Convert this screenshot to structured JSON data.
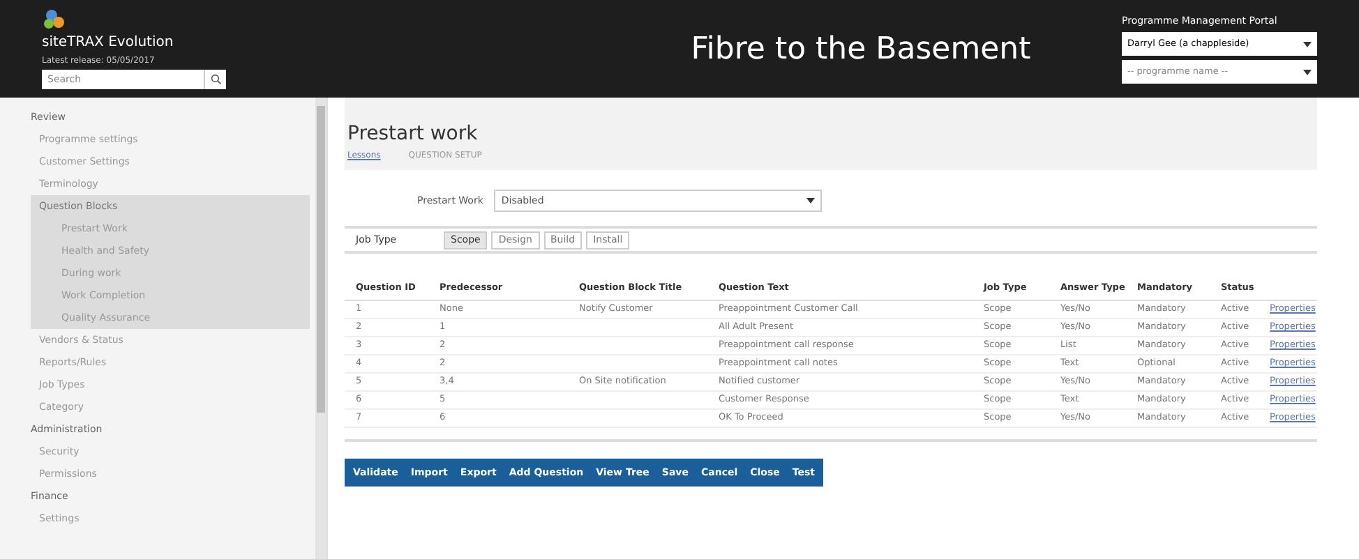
{
  "header": {
    "app_name": "siteTRAX Evolution",
    "release": "Latest release: 05/05/2017",
    "search": {
      "placeholder": "Search"
    },
    "page_title": "Fibre to the Basement",
    "portal_title": "Programme Management Portal",
    "user_select": "Darryl Gee (a chappleside)",
    "programme_select": "-- programme name --"
  },
  "sidebar": {
    "sections": [
      {
        "title": "Review",
        "items": [
          {
            "label": "Programme settings",
            "selected": false
          },
          {
            "label": "Customer Settings",
            "selected": false
          },
          {
            "label": "Terminology",
            "selected": false
          },
          {
            "label": "Question Blocks",
            "selected": true,
            "children": [
              {
                "label": "Prestart Work",
                "selected": false
              },
              {
                "label": "Health and Safety",
                "selected": false
              },
              {
                "label": "During work",
                "selected": false
              },
              {
                "label": "Work Completion",
                "selected": false
              },
              {
                "label": "Quality Assurance",
                "selected": false
              }
            ]
          },
          {
            "label": "Vendors & Status",
            "selected": false
          },
          {
            "label": "Reports/Rules",
            "selected": false
          },
          {
            "label": "Job Types",
            "selected": false
          },
          {
            "label": "Category",
            "selected": false
          }
        ]
      },
      {
        "title": "Administration",
        "items": [
          {
            "label": "Security",
            "selected": false
          },
          {
            "label": "Permissions",
            "selected": false
          }
        ]
      },
      {
        "title": "Finance",
        "items": [
          {
            "label": "Settings",
            "selected": false
          }
        ]
      }
    ]
  },
  "content": {
    "title": "Prestart work",
    "breadcrumbs": [
      "Lessons",
      "QUESTION SETUP"
    ],
    "prestart_label": "Prestart Work",
    "prestart_value": "Disabled",
    "job_type_label": "Job Type",
    "job_types": [
      {
        "label": "Scope",
        "selected": true
      },
      {
        "label": "Design",
        "selected": false
      },
      {
        "label": "Build",
        "selected": false
      },
      {
        "label": "Install",
        "selected": false
      }
    ],
    "table": {
      "columns": [
        "Question ID",
        "Predecessor",
        "Question Block Title",
        "Question Text",
        "Job Type",
        "Answer Type",
        "Mandatory",
        "Status"
      ],
      "rows": [
        {
          "cells": [
            "1",
            "None",
            "Notify Customer",
            "Preappointment Customer Call",
            "Scope",
            "Yes/No",
            "Mandatory",
            "Active"
          ],
          "link": "Properties"
        },
        {
          "cells": [
            "2",
            "1",
            "",
            "All Adult Present",
            "Scope",
            "Yes/No",
            "Mandatory",
            "Active"
          ],
          "link": "Properties"
        },
        {
          "cells": [
            "3",
            "2",
            "",
            "Preappointment call response",
            "Scope",
            "List",
            "Mandatory",
            "Active"
          ],
          "link": "Properties"
        },
        {
          "cells": [
            "4",
            "2",
            "",
            "Preappointment call notes",
            "Scope",
            "Text",
            "Optional",
            "Active"
          ],
          "link": "Properties"
        },
        {
          "cells": [
            "5",
            "3,4",
            "On Site notification",
            "Notified customer",
            "Scope",
            "Yes/No",
            "Mandatory",
            "Active"
          ],
          "link": "Properties"
        },
        {
          "cells": [
            "6",
            "5",
            "",
            "Customer Response",
            "Scope",
            "Text",
            "Mandatory",
            "Active"
          ],
          "link": "Properties"
        },
        {
          "cells": [
            "7",
            "6",
            "",
            "OK To Proceed",
            "Scope",
            "Yes/No",
            "Mandatory",
            "Active"
          ],
          "link": "Properties"
        }
      ]
    },
    "actions": [
      "Validate",
      "Import",
      "Export",
      "Add Question",
      "View Tree",
      "Save",
      "Cancel",
      "Close",
      "Test"
    ]
  }
}
